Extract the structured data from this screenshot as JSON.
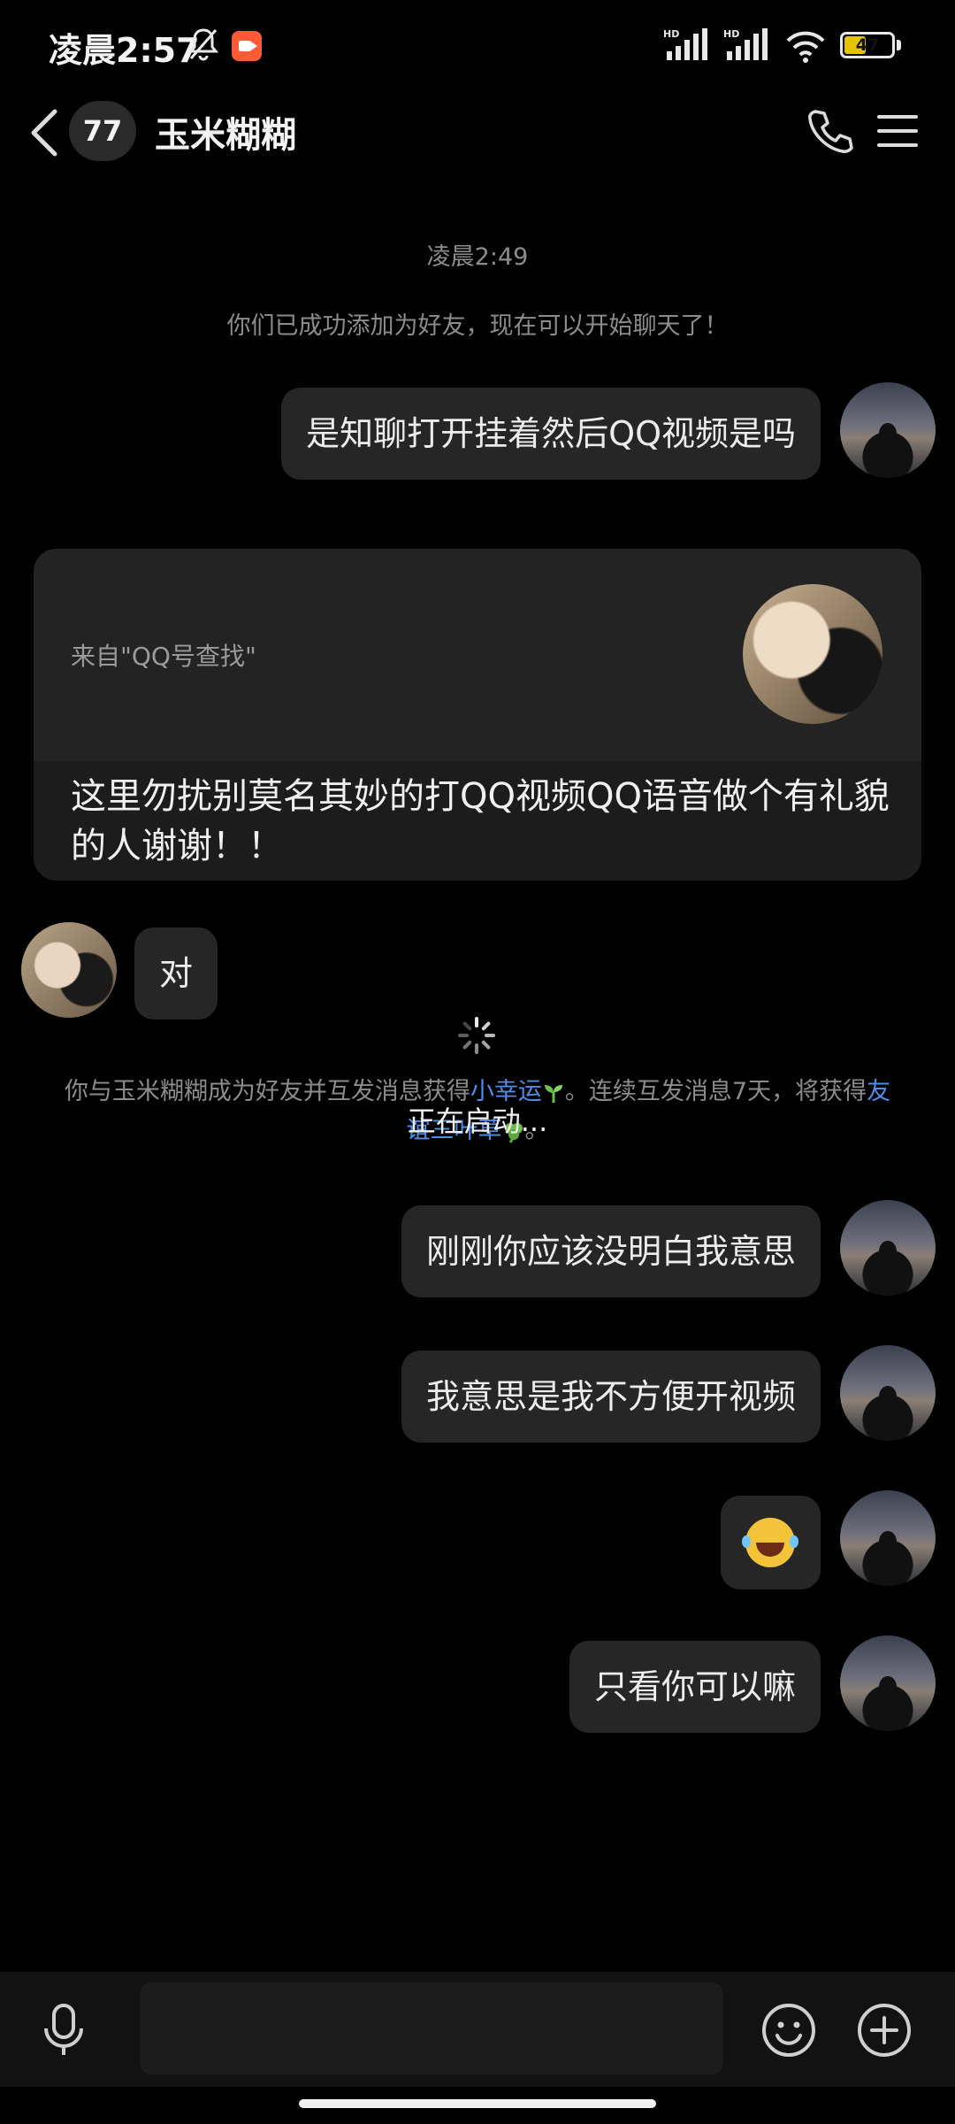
{
  "status_bar": {
    "time": "凌晨2:57",
    "signal_label_1": "HD",
    "signal_label_2": "HD",
    "battery": "47",
    "battery_level": 0.47
  },
  "nav": {
    "unread_count": "77",
    "title": "玉米糊糊"
  },
  "chat": {
    "timestamp": "凌晨2:49",
    "friend_added_notice": "你们已成功添加为好友，现在可以开始聊天了！",
    "messages": [
      {
        "sender": "me",
        "text": "是知聊打开挂着然后QQ视频是吗"
      },
      {
        "sender": "friend",
        "text": "对"
      },
      {
        "sender": "me",
        "text": "刚刚你应该没明白我意思"
      },
      {
        "sender": "me",
        "text": "我意思是我不方便开视频"
      },
      {
        "sender": "me",
        "text": "",
        "emoji": "laughing-tears"
      },
      {
        "sender": "me",
        "text": "只看你可以嘛"
      }
    ],
    "card": {
      "source": "来自\"QQ号查找\"",
      "text": " 这里勿扰别莫名其妙的打QQ视频QQ语音做个有礼貌的人谢谢！！"
    },
    "luck_notice": {
      "part1": "你与玉米糊糊成为好友并互发消息获得",
      "highlight1": "小幸运",
      "part2": "。连续互发消息7天，将获得",
      "highlight2": "友谊三叶草",
      "part3": "。"
    }
  },
  "overlay": {
    "loading_text": "正在启动..."
  },
  "input": {
    "placeholder": ""
  },
  "colors": {
    "background": "#000000",
    "bubble": "#262626",
    "link": "#4f8de8",
    "battery": "#e7c200"
  }
}
